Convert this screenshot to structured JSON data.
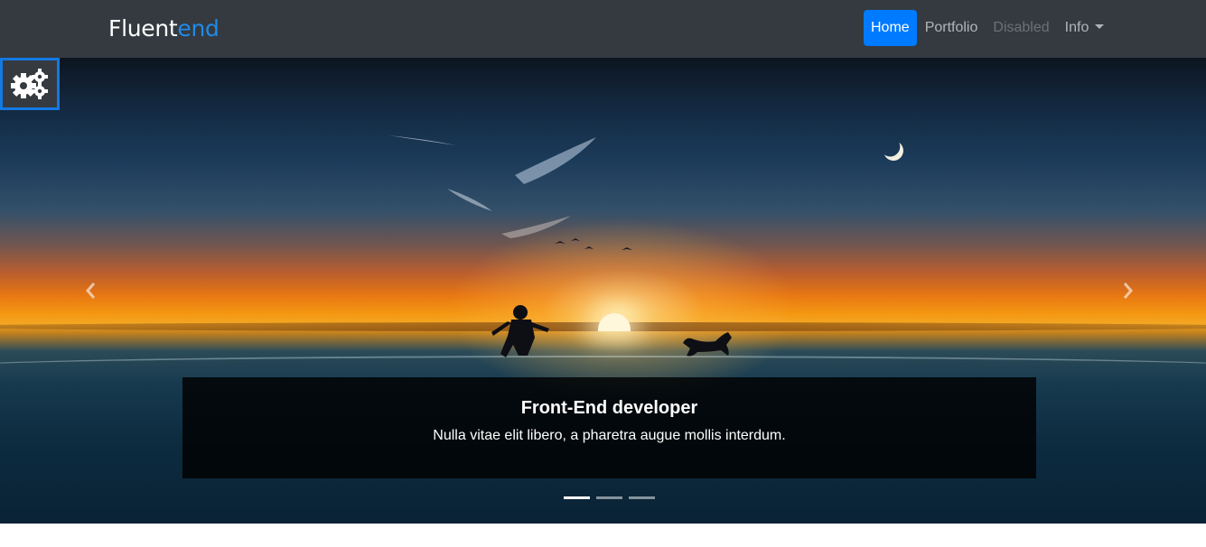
{
  "navbar": {
    "brand_main": "Fluent",
    "brand_accent": "end",
    "items": [
      {
        "label": "Home",
        "state": "active"
      },
      {
        "label": "Portfolio",
        "state": "normal"
      },
      {
        "label": "Disabled",
        "state": "disabled"
      },
      {
        "label": "Info",
        "state": "dropdown"
      }
    ]
  },
  "carousel": {
    "caption_title": "Front-End developer",
    "caption_text": "Nulla vitae elit libero, a pharetra augue mollis interdum.",
    "slide_count": 3,
    "active_slide": 1,
    "prev_icon": "chevron-left-icon",
    "next_icon": "chevron-right-icon"
  },
  "settings_toggle": {
    "icon": "gears-icon"
  },
  "colors": {
    "navbar_bg": "#343a40",
    "brand_accent": "#1f8ae8",
    "active_link": "#007bff",
    "toggle_border": "#1479e3"
  }
}
